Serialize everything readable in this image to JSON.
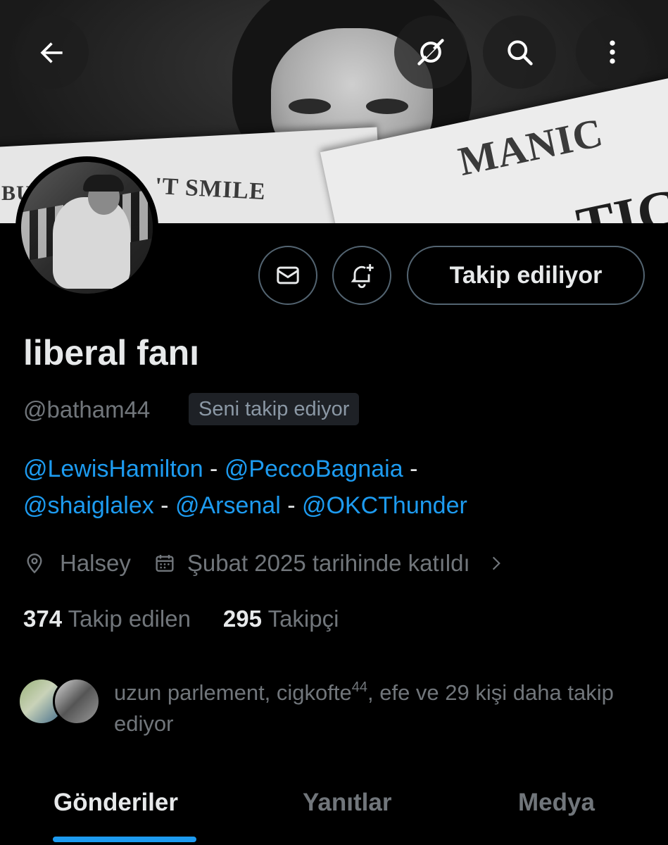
{
  "banner": {
    "paper_words": [
      "MANIC",
      "'T SMILE",
      "BU",
      "TIC"
    ]
  },
  "top_bar": {
    "back_icon": "arrow-left-icon",
    "grok_icon": "grok-icon",
    "search_icon": "search-icon",
    "more_icon": "more-vertical-icon"
  },
  "actions": {
    "dm_icon": "envelope-icon",
    "notify_icon": "bell-plus-icon",
    "following_label": "Takip ediliyor"
  },
  "profile": {
    "display_name": "liberal fanı",
    "handle": "@batham44",
    "follows_you": "Seni takip ediyor",
    "bio": [
      {
        "text": "@LewisHamilton",
        "type": "mention"
      },
      {
        "text": " - ",
        "type": "text"
      },
      {
        "text": "@PeccoBagnaia",
        "type": "mention"
      },
      {
        "text": " - ",
        "type": "text"
      },
      {
        "text": "@shaiglalex",
        "type": "mention"
      },
      {
        "text": " - ",
        "type": "text"
      },
      {
        "text": "@Arsenal",
        "type": "mention"
      },
      {
        "text": " - ",
        "type": "text"
      },
      {
        "text": "@OKCThunder",
        "type": "mention"
      }
    ],
    "location": "Halsey",
    "joined": "Şubat 2025 tarihinde katıldı"
  },
  "stats": {
    "following_count": "374",
    "following_label": "Takip edilen",
    "followers_count": "295",
    "followers_label": "Takipçi"
  },
  "known_followers": {
    "text_before": "uzun parlement, cigkofte",
    "superscript": "44",
    "text_after": ", efe ve 29 kişi daha takip ediyor"
  },
  "tabs": [
    {
      "label": "Gönderiler",
      "active": true
    },
    {
      "label": "Yanıtlar",
      "active": false
    },
    {
      "label": "Medya",
      "active": false
    }
  ],
  "colors": {
    "accent": "#1d9bf0",
    "background": "#000000",
    "text_primary": "#e7e9ea",
    "text_secondary": "#71767b",
    "border": "#536471"
  }
}
